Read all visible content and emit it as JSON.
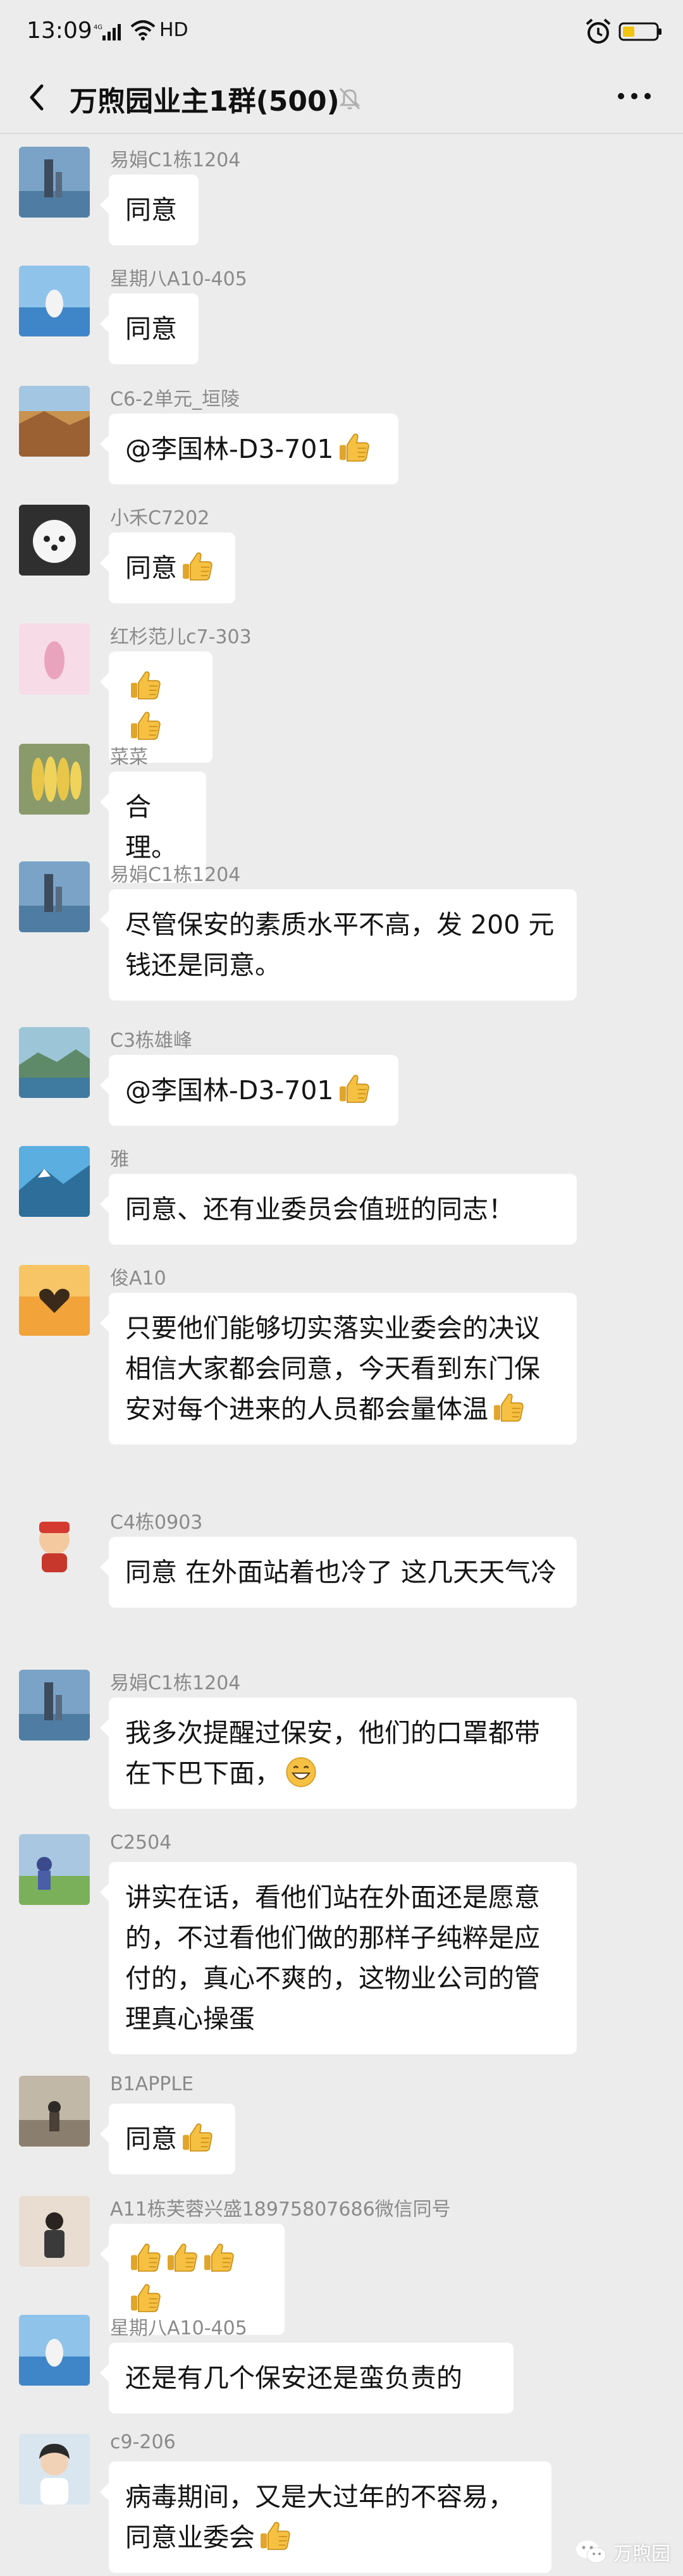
{
  "status_bar": {
    "time": "13:09",
    "network": "HD"
  },
  "header": {
    "title": "万煦园业主1群(500)"
  },
  "messages": [
    {
      "sender": "易娟C1栋1204",
      "text": "同意"
    },
    {
      "sender": "星期八A10-405",
      "text": "同意"
    },
    {
      "sender": "C6-2单元_垣陵",
      "text": "@李国林-D3-701"
    },
    {
      "sender": "小禾C7202",
      "text": "同意"
    },
    {
      "sender": "红杉范儿c7-303",
      "text": ""
    },
    {
      "sender": "菜菜",
      "text": "合理。"
    },
    {
      "sender": "易娟C1栋1204",
      "text": "尽管保安的素质水平不高，发 200 元钱还是同意。"
    },
    {
      "sender": "C3栋雄峰",
      "text": "@李国林-D3-701"
    },
    {
      "sender": "雅",
      "text": "同意、还有业委员会值班的同志！"
    },
    {
      "sender": "俊A10",
      "text": "只要他们能够切实落实业委会的决议相信大家都会同意，今天看到东门保安对每个进来的人员都会量体温"
    },
    {
      "sender": "C4栋0903",
      "text": "同意 在外面站着也冷了 这几天天气冷"
    },
    {
      "sender": "易娟C1栋1204",
      "text": "我多次提醒过保安，他们的口罩都带在下巴下面，"
    },
    {
      "sender": "C2504",
      "text": "讲实在话，看他们站在外面还是愿意的，不过看他们做的那样子纯粹是应付的，真心不爽的，这物业公司的管理真心操蛋"
    },
    {
      "sender": "B1APPLE",
      "text": "同意"
    },
    {
      "sender": "A11栋芙蓉兴盛18975807686微信同号",
      "text": ""
    },
    {
      "sender": "星期八A10-405",
      "text": "还是有几个保安还是蛮负责的"
    },
    {
      "sender": "c9-206",
      "text": "病毒期间，又是大过年的不容易，同意业委会"
    }
  ],
  "watermark": {
    "text": "万煦园"
  },
  "icons": {
    "thumbs_up": "thumbs-up-emoji",
    "grin": "grinning-emoji",
    "back": "back-arrow",
    "mute": "mute-bell",
    "more": "more-dots"
  },
  "colors": {
    "background": "#ececec",
    "bubble": "#ffffff",
    "sender_text": "#8a8a8a",
    "emoji": "#f6c143"
  }
}
